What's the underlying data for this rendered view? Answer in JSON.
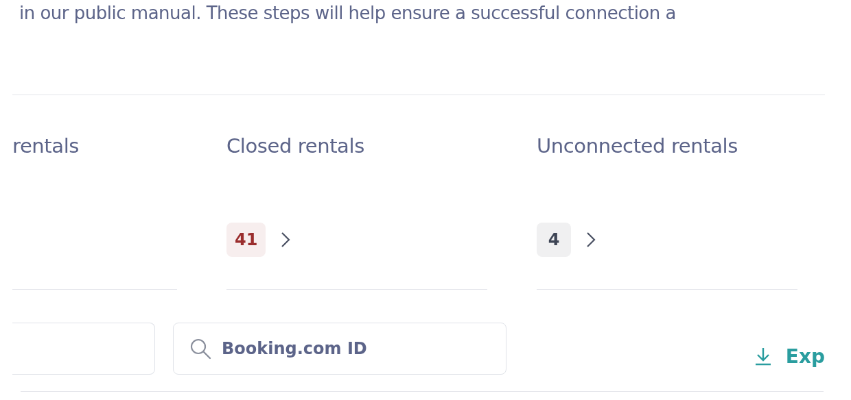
{
  "intro": "in our public manual. These steps will help ensure a successful connection a",
  "cards": [
    {
      "title": "rentals"
    },
    {
      "title": "Closed rentals",
      "count": "41",
      "color": "#9a2d2d"
    },
    {
      "title": "Unconnected rentals",
      "count": "4",
      "color": "#3e4555"
    }
  ],
  "filters": [
    {
      "kind": "text"
    },
    {
      "kind": "search",
      "placeholder": "Booking.com ID"
    }
  ],
  "export": {
    "label": "Exp"
  }
}
